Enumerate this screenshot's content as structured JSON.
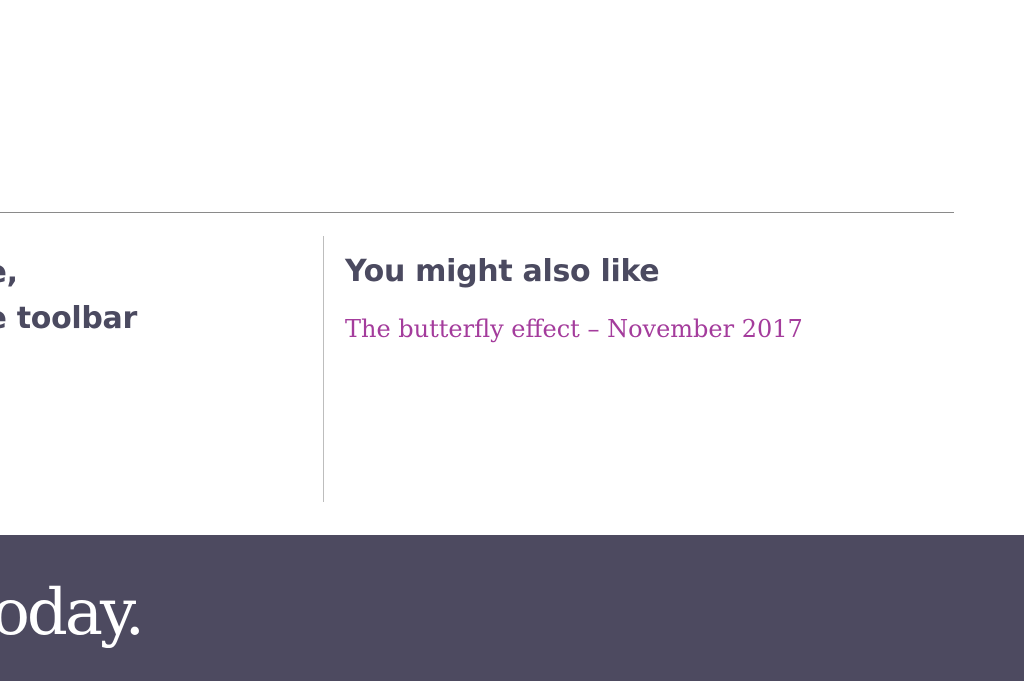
{
  "article_end": {
    "partial_text_line1": "e,",
    "partial_text_line2": "e toolbar"
  },
  "related": {
    "heading": "You might also like",
    "link_text": "The butterfly effect – November 2017"
  },
  "footer": {
    "logo_text": "oday."
  },
  "colors": {
    "heading_text": "#4b4a60",
    "link": "#a43c9c",
    "footer_bg": "#4d4a60",
    "footer_text": "#ffffff"
  }
}
